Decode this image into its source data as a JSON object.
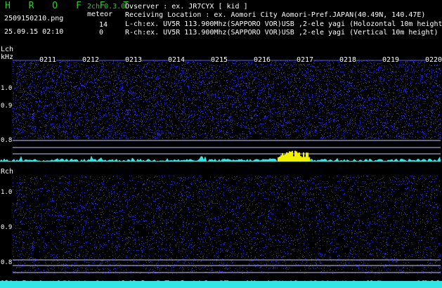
{
  "app": {
    "logo": "H R O F F T",
    "version": "2ch 0.3.0",
    "filename": "2509150210.png",
    "meteor_label": "meteor",
    "l_count": "14",
    "r_count": "0",
    "timestamp": "25.09.15 02:10"
  },
  "header": {
    "observer": "Ovserver           : ex. JR7CYX [ kid ]",
    "location": "Receiving Location : ex. Aomori City Aomori-Pref.JAPAN(40.49N, 140.47E)",
    "lch": "L-ch:ex. UV5R 113.900Mhz(SAPPORO VOR)USB ,2-ele yagi (Holozontal 10m height)",
    "rch": "R-ch:ex. UV5R 113.900Mhz(SAPPORO VOR)USB ,2-ele yagi (Vertical 10m height)"
  },
  "lpanel": {
    "label": "Lch",
    "unit": "kHz",
    "ticks": [
      "1.0",
      "0.9",
      "0.8"
    ],
    "time_labels": [
      "0211",
      "0212",
      "0213",
      "0214",
      "0215",
      "0216",
      "0217",
      "0218",
      "0219",
      "0220"
    ]
  },
  "rpanel": {
    "label": "Rch",
    "ticks": [
      "1.0",
      "0.9",
      "0.8"
    ]
  },
  "colors": {
    "logo_green": "#2ecc2e",
    "noise_blue": "#2b2bd6",
    "trace_cyan": "#33e6e6",
    "meteor_yellow": "#f0f000",
    "grid_line": "#c8c8ff"
  }
}
